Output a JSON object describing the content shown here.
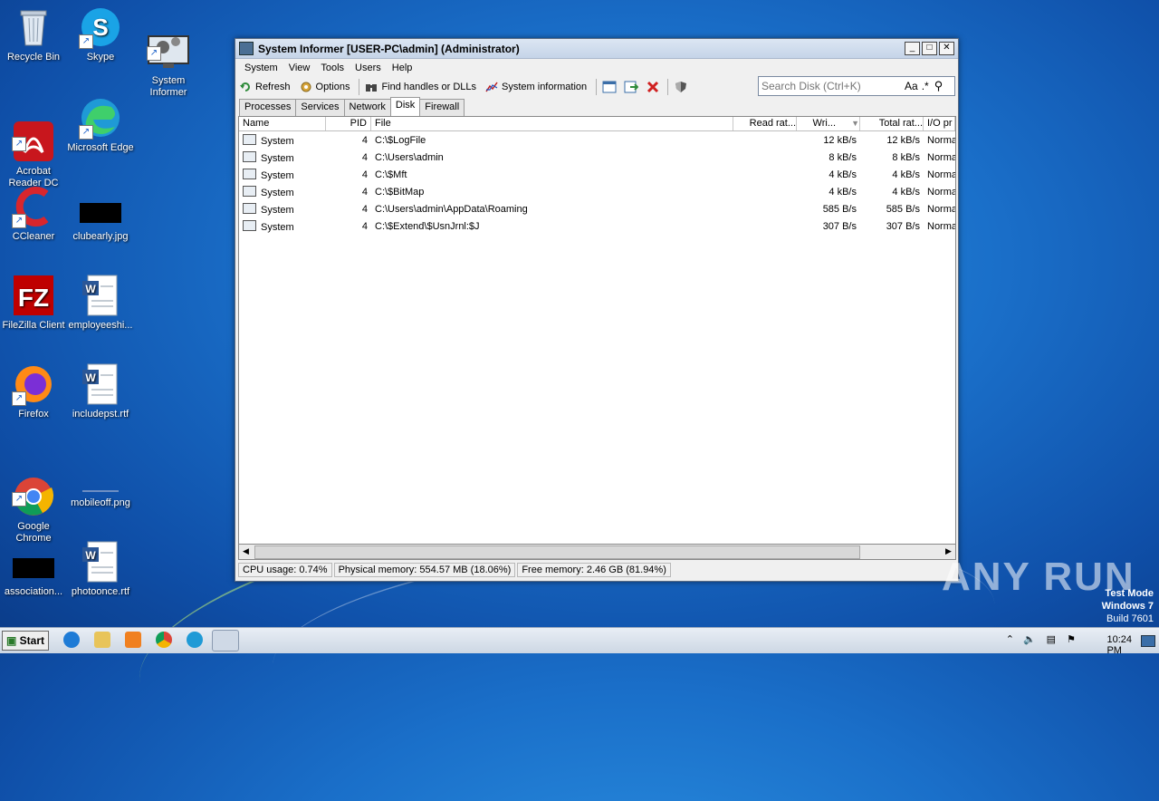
{
  "desktop": {
    "icons": [
      {
        "label": "Recycle Bin"
      },
      {
        "label": "Skype"
      },
      {
        "label": "System\nInformer"
      },
      {
        "label": "Acrobat\nReader DC"
      },
      {
        "label": "Microsoft Edge"
      },
      {
        "label": "CCleaner"
      },
      {
        "label": "clubearly.jpg"
      },
      {
        "label": "FileZilla Client"
      },
      {
        "label": "employeeshi..."
      },
      {
        "label": "Firefox"
      },
      {
        "label": "includepst.rtf"
      },
      {
        "label": "Google\nChrome"
      },
      {
        "label": "mobileoff.png"
      },
      {
        "label": "association..."
      },
      {
        "label": "photoonce.rtf"
      }
    ]
  },
  "window": {
    "title": "System Informer [USER-PC\\admin] (Administrator)",
    "menu": [
      "System",
      "View",
      "Tools",
      "Users",
      "Help"
    ],
    "toolbar": {
      "refresh": "Refresh",
      "options": "Options",
      "find_handles": "Find handles or DLLs",
      "system_info": "System information"
    },
    "search": {
      "placeholder": "Search Disk (Ctrl+K)",
      "case_label": "Aa",
      "regex_label": ".*"
    },
    "tabs": [
      "Processes",
      "Services",
      "Network",
      "Disk",
      "Firewall"
    ],
    "active_tab": "Disk",
    "columns": [
      "Name",
      "PID",
      "File",
      "Read rat...",
      "Wri...",
      "Total rat...",
      "I/O pr"
    ],
    "rows": [
      {
        "name": "System",
        "pid": "4",
        "file": "C:\\$LogFile",
        "read": "",
        "write": "12 kB/s",
        "total": "12 kB/s",
        "io": "Normal"
      },
      {
        "name": "System",
        "pid": "4",
        "file": "C:\\Users\\admin",
        "read": "",
        "write": "8 kB/s",
        "total": "8 kB/s",
        "io": "Normal"
      },
      {
        "name": "System",
        "pid": "4",
        "file": "C:\\$Mft",
        "read": "",
        "write": "4 kB/s",
        "total": "4 kB/s",
        "io": "Normal"
      },
      {
        "name": "System",
        "pid": "4",
        "file": "C:\\$BitMap",
        "read": "",
        "write": "4 kB/s",
        "total": "4 kB/s",
        "io": "Normal"
      },
      {
        "name": "System",
        "pid": "4",
        "file": "C:\\Users\\admin\\AppData\\Roaming",
        "read": "",
        "write": "585 B/s",
        "total": "585 B/s",
        "io": "Normal"
      },
      {
        "name": "System",
        "pid": "4",
        "file": "C:\\$Extend\\$UsnJrnl:$J",
        "read": "",
        "write": "307 B/s",
        "total": "307 B/s",
        "io": "Normal"
      }
    ],
    "status": {
      "cpu": "CPU usage: 0.74%",
      "physical": "Physical memory: 554.57 MB (18.06%)",
      "free": "Free memory: 2.46 GB (81.94%)"
    }
  },
  "taskbar": {
    "start": "Start",
    "clock": "10:24 PM"
  },
  "watermark": {
    "text": "ANY RUN",
    "line1": "Test Mode",
    "line2": "Windows 7",
    "line3": "Build 7601"
  }
}
